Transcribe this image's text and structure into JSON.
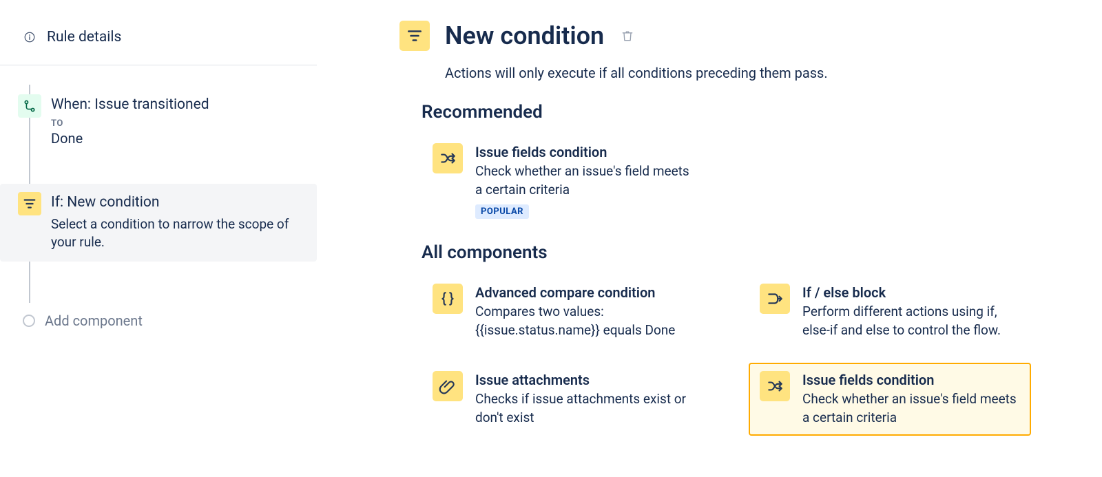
{
  "sidebar": {
    "rule_details_label": "Rule details",
    "trigger": {
      "title": "When: Issue transitioned",
      "meta_label": "TO",
      "meta_value": "Done"
    },
    "condition": {
      "title": "If: New condition",
      "desc": "Select a condition to narrow the scope of your rule."
    },
    "add_label": "Add component"
  },
  "main": {
    "title": "New condition",
    "subtitle": "Actions will only execute if all conditions preceding them pass.",
    "recommended_heading": "Recommended",
    "all_heading": "All components",
    "recommended": [
      {
        "icon": "shuffle",
        "title": "Issue fields condition",
        "desc": "Check whether an issue's field meets a certain criteria",
        "badge": "POPULAR"
      }
    ],
    "components": [
      {
        "icon": "braces",
        "title": "Advanced compare condition",
        "desc": "Compares two values: {{issue.status.name}} equals Done"
      },
      {
        "icon": "branch",
        "title": "If / else block",
        "desc": "Perform different actions using if, else-if and else to control the flow."
      },
      {
        "icon": "attachment",
        "title": "Issue attachments",
        "desc": "Checks if issue attachments exist or don't exist"
      },
      {
        "icon": "shuffle",
        "title": "Issue fields condition",
        "desc": "Check whether an issue's field meets a certain criteria",
        "highlight": true
      }
    ]
  }
}
